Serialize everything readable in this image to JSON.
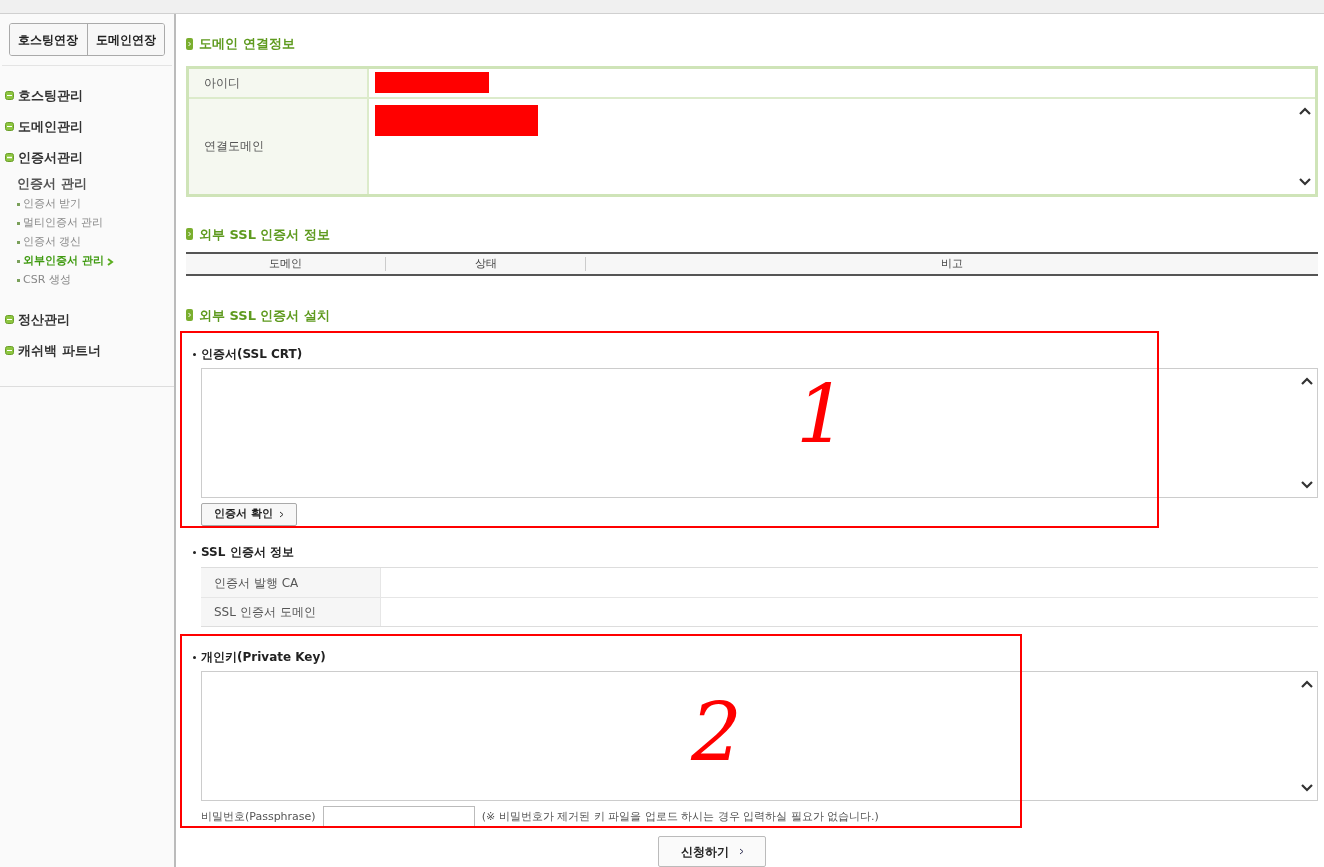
{
  "sidebar": {
    "buttons": [
      "호스팅연장",
      "도메인연장"
    ],
    "menus": [
      {
        "label": "호스팅관리",
        "expanded": false
      },
      {
        "label": "도메인관리",
        "expanded": false
      },
      {
        "label": "인증서관리",
        "expanded": true,
        "title": "인증서 관리",
        "children": [
          {
            "label": "인증서 받기",
            "selected": false
          },
          {
            "label": "멀티인증서 관리",
            "selected": false
          },
          {
            "label": "인증서 갱신",
            "selected": false
          },
          {
            "label": "외부인증서 관리",
            "selected": true
          },
          {
            "label": "CSR 생성",
            "selected": false
          }
        ]
      },
      {
        "label": "정산관리",
        "expanded": false
      },
      {
        "label": "캐쉬백 파트너",
        "expanded": false
      }
    ]
  },
  "domain_info": {
    "heading": "도메인 연결정보",
    "rows": [
      {
        "label": "아이디"
      },
      {
        "label": "연결도메인"
      }
    ]
  },
  "ssl_info": {
    "heading": "외부 SSL 인증서 정보",
    "columns": [
      "도메인",
      "상태",
      "비고"
    ]
  },
  "install": {
    "heading": "외부 SSL 인증서 설치",
    "certificate": {
      "label": "인증서(SSL CRT)",
      "button": "인증서 확인",
      "annotation": "1"
    },
    "cert_info": {
      "label": "SSL 인증서 정보",
      "rows": [
        "인증서 발행 CA",
        "SSL 인증서 도메인"
      ]
    },
    "private_key": {
      "label": "개인키(Private Key)",
      "annotation": "2",
      "passphrase_label": "비밀번호(Passphrase)",
      "note": "(※ 비밀번호가 제거된 키 파일을 업로드 하시는 경우 입력하실 필요가 없습니다.)"
    },
    "submit": "신청하기"
  }
}
